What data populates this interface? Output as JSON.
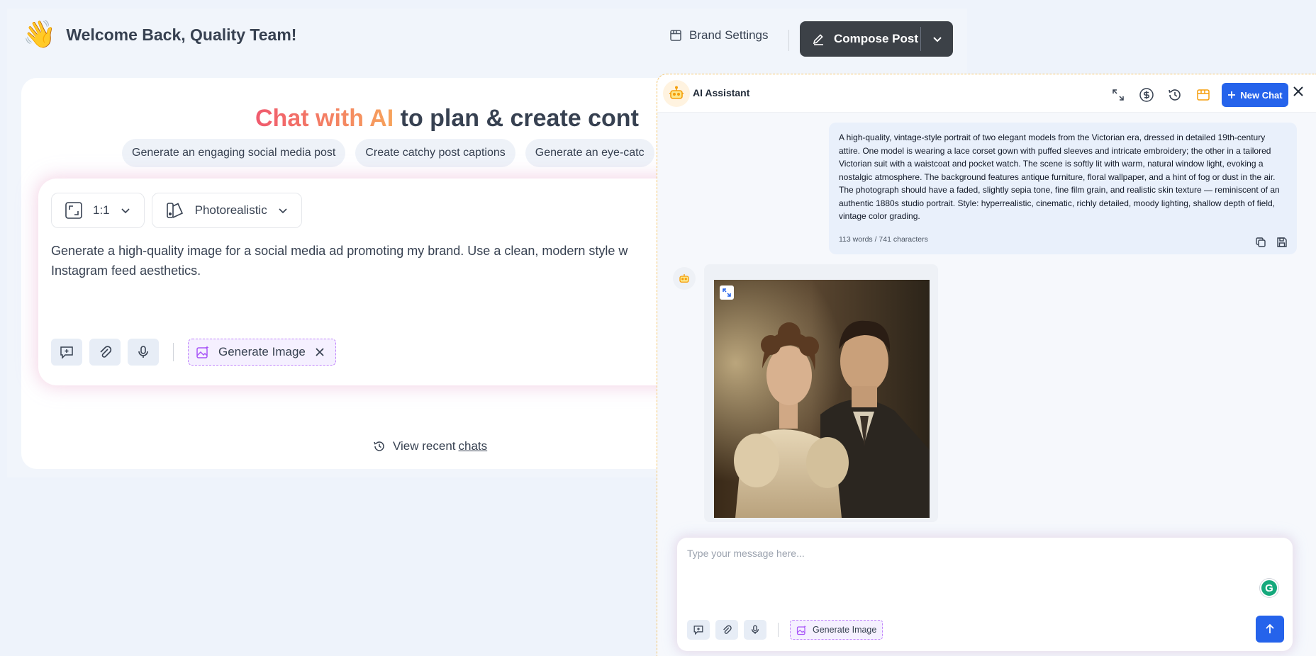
{
  "header": {
    "greeting_emoji": "👋",
    "welcome": "Welcome Back, Quality Team!",
    "brand_settings": "Brand Settings",
    "compose_post": "Compose Post"
  },
  "hero": {
    "highlight": "Chat with AI",
    "rest": " to plan & create cont"
  },
  "suggestions": [
    "Generate an engaging social media post",
    "Create catchy post captions",
    "Generate an eye-catc"
  ],
  "composer": {
    "aspect_ratio": "1:1",
    "style": "Photorealistic",
    "prompt_line1": "Generate a high-quality image for a social media ad promoting my brand. Use a clean, modern style w",
    "prompt_line2": "Instagram feed aesthetics.",
    "mode_pill": "Generate Image"
  },
  "recent": {
    "prefix": "View recent ",
    "link": "chats"
  },
  "assistant": {
    "title": "AI Assistant",
    "new_chat": "New Chat",
    "user_message": "A high-quality, vintage-style portrait of two elegant models from the Victorian era, dressed in detailed 19th-century attire. One model is wearing a lace corset gown with puffed sleeves and intricate embroidery; the other in a tailored Victorian suit with a waistcoat and pocket watch. The scene is softly lit with warm, natural window light, evoking a nostalgic atmosphere. The background features antique furniture, floral wallpaper, and a hint of fog or dust in the air. The photograph should have a faded, slightly sepia tone, fine film grain, and realistic skin texture — reminiscent of an authentic 1880s studio portrait. Style: hyperrealistic, cinematic, richly detailed, moody lighting, shallow depth of field, vintage color grading.",
    "message_meta": "113 words / 741 characters",
    "input_placeholder": "Type your message here...",
    "mode_pill": "Generate Image",
    "grammarly_letter": "G"
  },
  "colors": {
    "accent_blue": "#2563eb",
    "compose_dark": "#3c4147",
    "hero_gradient_start": "#f05a6e",
    "hero_gradient_end": "#f7a35b",
    "panel_dash": "#f5c56b",
    "gen_pill_dash": "#c084fc"
  }
}
